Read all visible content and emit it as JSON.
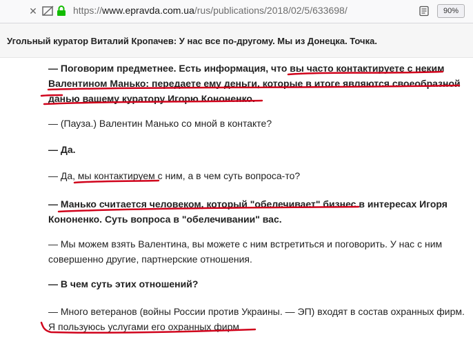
{
  "browser": {
    "url_protocol": "https://",
    "url_host": "www.epravda.com.ua",
    "url_path": "/rus/publications/2018/02/5/633698/",
    "zoom_level": "90%"
  },
  "article": {
    "title": "Угольный куратор Виталий Кропачев: У нас все по-другому. Мы из Донецка. Точка.",
    "paragraphs": [
      {
        "line1": "— Поговорим предметнее. Есть информация, что вы часто контактируете с неким",
        "line2": "Валентином Манько: передаете ему деньги, которые в итоге являются своеобразной",
        "line3": "данью вашему куратору Игорю Кононенко."
      },
      {
        "line1": "— (Пауза.) Валентин Манько со мной в контакте?"
      },
      {
        "line1": "— Да."
      },
      {
        "line1": "— Да, мы контактируем с ним, а в чем суть вопроса-то?"
      },
      {
        "line1": "— Манько считается человеком, который \"обелечивает\" бизнес в интересах Игоря",
        "line2": "Кононенко. Суть вопроса в \"обелечивании\" вас."
      },
      {
        "line1": "— Мы можем взять Валентина, вы можете с ним встретиться и поговорить. У нас с ним",
        "line2": "совершенно другие, партнерские отношения."
      },
      {
        "line1": "— В чем суть этих отношений?"
      },
      {
        "line1": "— Много ветеранов (войны России против Украины. — ЭП) входят в состав охранных фирм.",
        "line2": "Я пользуюсь услугами его охранных фирм."
      }
    ]
  },
  "colors": {
    "underline": "#d0021b",
    "text": "#222222",
    "secure_lock": "#12bc00"
  }
}
